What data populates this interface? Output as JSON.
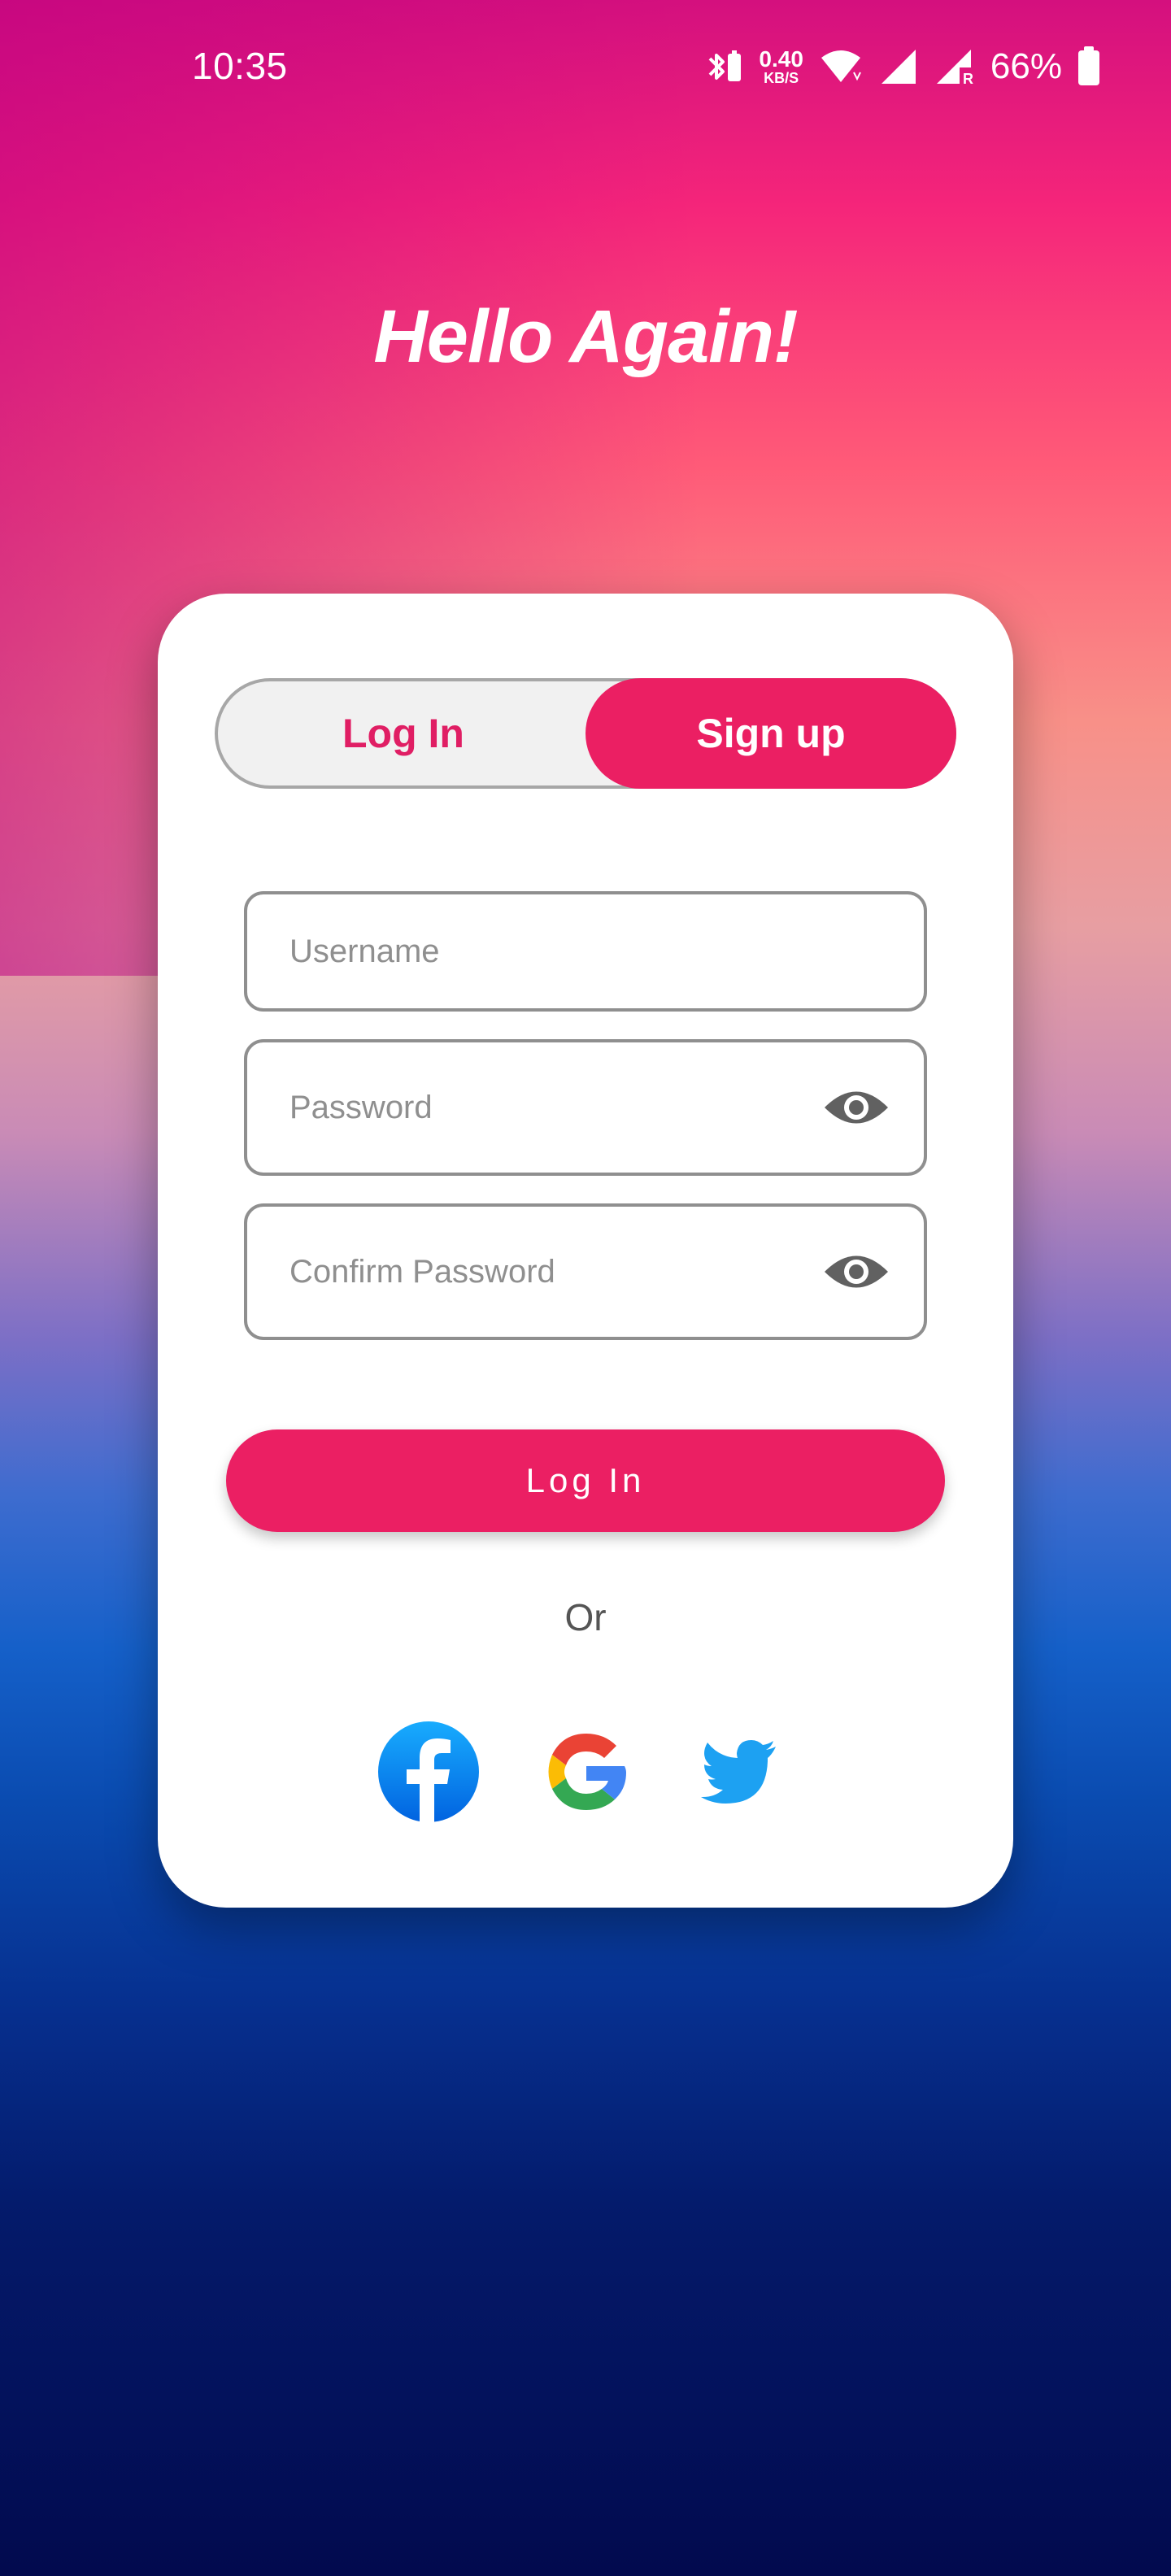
{
  "status_bar": {
    "time": "10:35",
    "speed_value": "0.40",
    "speed_unit": "KB/S",
    "battery": "66%",
    "icons": [
      "bluetooth-icon",
      "wifi-icon",
      "signal-icon",
      "signal-roaming-icon",
      "battery-icon"
    ]
  },
  "header": {
    "title": "Hello Again!"
  },
  "auth_toggle": {
    "login_label": "Log In",
    "signup_label": "Sign up",
    "active": "signup"
  },
  "form": {
    "username_placeholder": "Username",
    "password_placeholder": "Password",
    "confirm_password_placeholder": "Confirm Password"
  },
  "primary_button": {
    "label": "Log In"
  },
  "divider": {
    "or_label": "Or"
  },
  "social": [
    "facebook-icon",
    "google-icon",
    "twitter-icon"
  ],
  "colors": {
    "accent": "#eb1f63",
    "field_border": "#8f8f8f",
    "placeholder": "#8f8f8f"
  }
}
